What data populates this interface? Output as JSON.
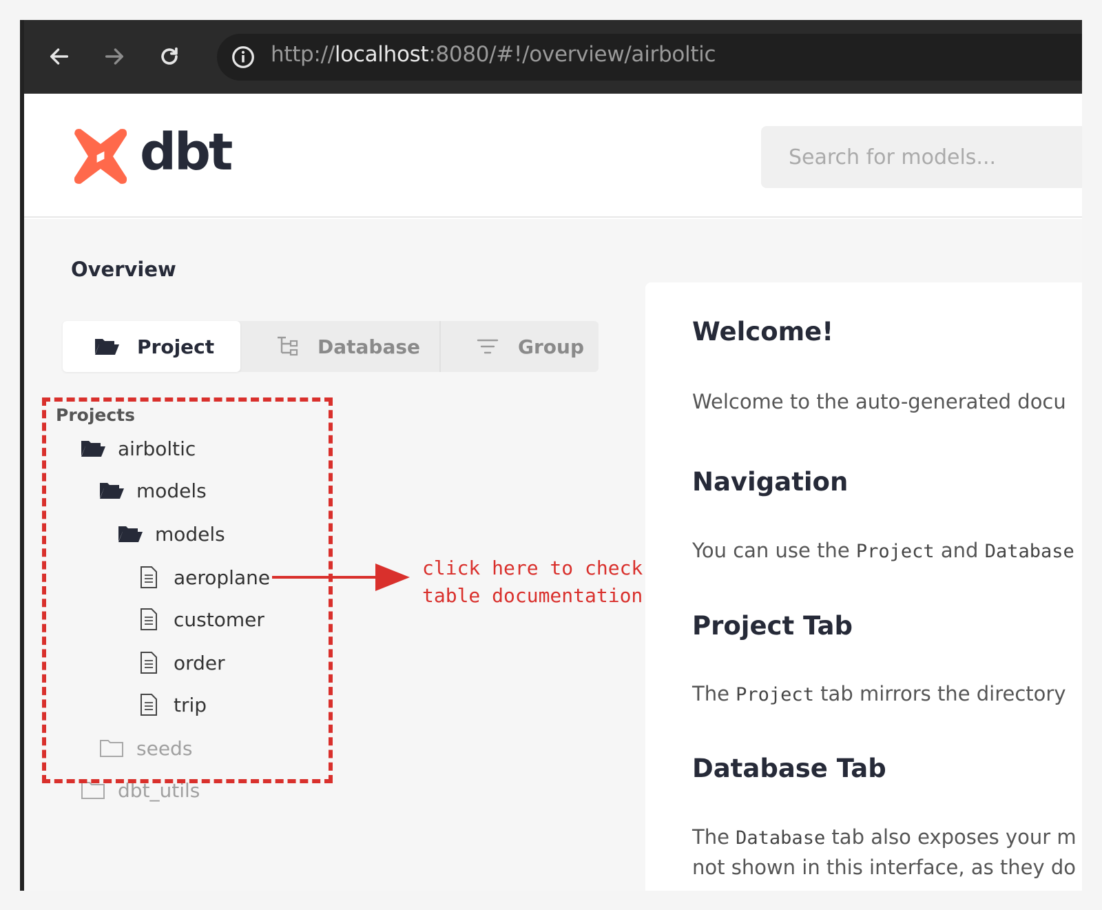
{
  "browser": {
    "url_scheme": "http://",
    "url_host": "localhost",
    "url_rest": ":8080/#!/overview/airboltic"
  },
  "header": {
    "logo_text": "dbt",
    "search_placeholder": "Search for models..."
  },
  "overview": {
    "title": "Overview",
    "tabs": [
      {
        "label": "Project",
        "icon": "folder-open-icon",
        "active": true
      },
      {
        "label": "Database",
        "icon": "tree-icon",
        "active": false
      },
      {
        "label": "Group",
        "icon": "filter-icon",
        "active": false
      }
    ]
  },
  "tree": {
    "label": "Projects",
    "nodes": [
      {
        "label": "airboltic",
        "icon": "folder-open-icon"
      },
      {
        "label": "models",
        "icon": "folder-open-icon"
      },
      {
        "label": "models",
        "icon": "folder-open-icon"
      },
      {
        "label": "aeroplane",
        "icon": "file-icon"
      },
      {
        "label": "customer",
        "icon": "file-icon"
      },
      {
        "label": "order",
        "icon": "file-icon"
      },
      {
        "label": "trip",
        "icon": "file-icon"
      },
      {
        "label": "seeds",
        "icon": "folder-closed-icon"
      },
      {
        "label": "dbt_utils",
        "icon": "folder-closed-icon"
      }
    ]
  },
  "annotation": {
    "line1": "click here to check",
    "line2": "table documentation",
    "color": "#d9302c"
  },
  "welcome": {
    "title": "Welcome!",
    "intro": "Welcome to the auto-generated docu",
    "nav_title": "Navigation",
    "nav_text_a": "You can use the ",
    "nav_code_a": "Project",
    "nav_text_b": " and ",
    "nav_code_b": "Database",
    "project_tab_title": "Project Tab",
    "project_text_a": "The ",
    "project_code": "Project",
    "project_text_b": " tab mirrors the directory",
    "database_tab_title": "Database Tab",
    "database_text_a": "The ",
    "database_code": "Database",
    "database_text_b": " tab also exposes your m",
    "database_text_line2": "not shown in this interface, as they do"
  },
  "colors": {
    "brand": "#ff694b",
    "browser_bar": "#2b2b2b",
    "annotation_red": "#d9302c"
  }
}
